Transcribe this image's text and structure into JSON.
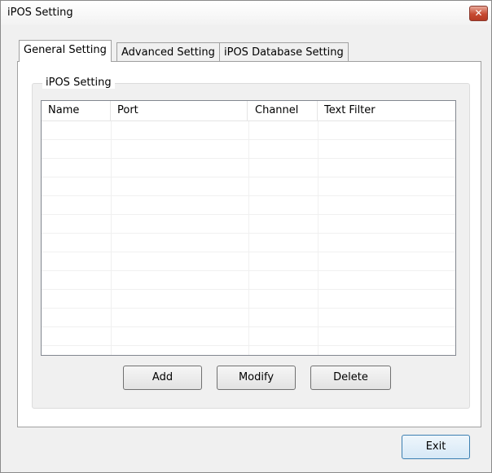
{
  "window": {
    "title": "iPOS Setting",
    "close_glyph": "✕"
  },
  "tabs": [
    {
      "label": "General Setting",
      "active": true
    },
    {
      "label": "Advanced Setting",
      "active": false
    },
    {
      "label": "iPOS Database Setting",
      "active": false
    }
  ],
  "group": {
    "label": "iPOS Setting"
  },
  "table": {
    "columns": [
      "Name",
      "Port",
      "Channel",
      "Text Filter"
    ],
    "rows": []
  },
  "buttons": {
    "add": "Add",
    "modify": "Modify",
    "delete": "Delete",
    "exit": "Exit"
  }
}
